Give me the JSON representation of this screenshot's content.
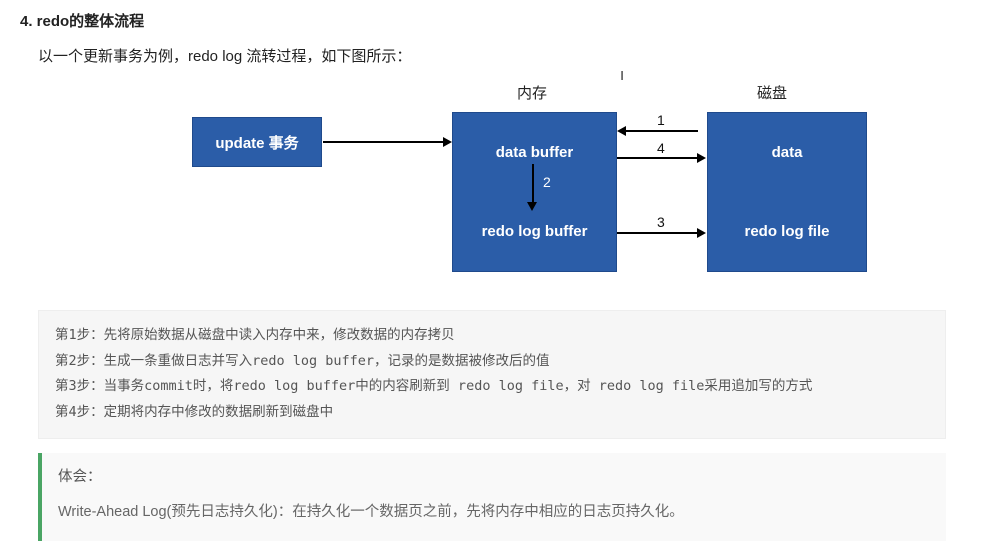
{
  "heading": "4. redo的整体流程",
  "intro": "以一个更新事务为例，redo log 流转过程，如下图所示：",
  "cursor": "I",
  "diagram": {
    "col_mem": "内存",
    "col_disk": "磁盘",
    "box_update": "update 事务",
    "mem_top": "data buffer",
    "mem_bot": "redo log buffer",
    "disk_top": "data",
    "disk_bot": "redo log file",
    "n1": "1",
    "n2": "2",
    "n3": "3",
    "n4": "4"
  },
  "steps": {
    "s1": "第1步：先将原始数据从磁盘中读入内存中来，修改数据的内存拷贝",
    "s2": "第2步：生成一条重做日志并写入redo log buffer，记录的是数据被修改后的值",
    "s3": "第3步：当事务commit时，将redo log buffer中的内容刷新到 redo log file，对 redo log file采用追加写的方式",
    "s4": "第4步：定期将内存中修改的数据刷新到磁盘中"
  },
  "note": {
    "title": "体会：",
    "body": "Write-Ahead Log(预先日志持久化)：在持久化一个数据页之前，先将内存中相应的日志页持久化。"
  },
  "chart_data": {
    "type": "diagram",
    "nodes": [
      {
        "id": "update",
        "label": "update 事务",
        "group": null
      },
      {
        "id": "data_buffer",
        "label": "data buffer",
        "group": "内存"
      },
      {
        "id": "redo_log_buffer",
        "label": "redo log buffer",
        "group": "内存"
      },
      {
        "id": "data",
        "label": "data",
        "group": "磁盘"
      },
      {
        "id": "redo_log_file",
        "label": "redo log file",
        "group": "磁盘"
      }
    ],
    "edges": [
      {
        "from": "update",
        "to": "data_buffer",
        "label": ""
      },
      {
        "from": "data",
        "to": "data_buffer",
        "label": "1"
      },
      {
        "from": "data_buffer",
        "to": "redo_log_buffer",
        "label": "2"
      },
      {
        "from": "redo_log_buffer",
        "to": "redo_log_file",
        "label": "3"
      },
      {
        "from": "data_buffer",
        "to": "data",
        "label": "4"
      }
    ]
  }
}
